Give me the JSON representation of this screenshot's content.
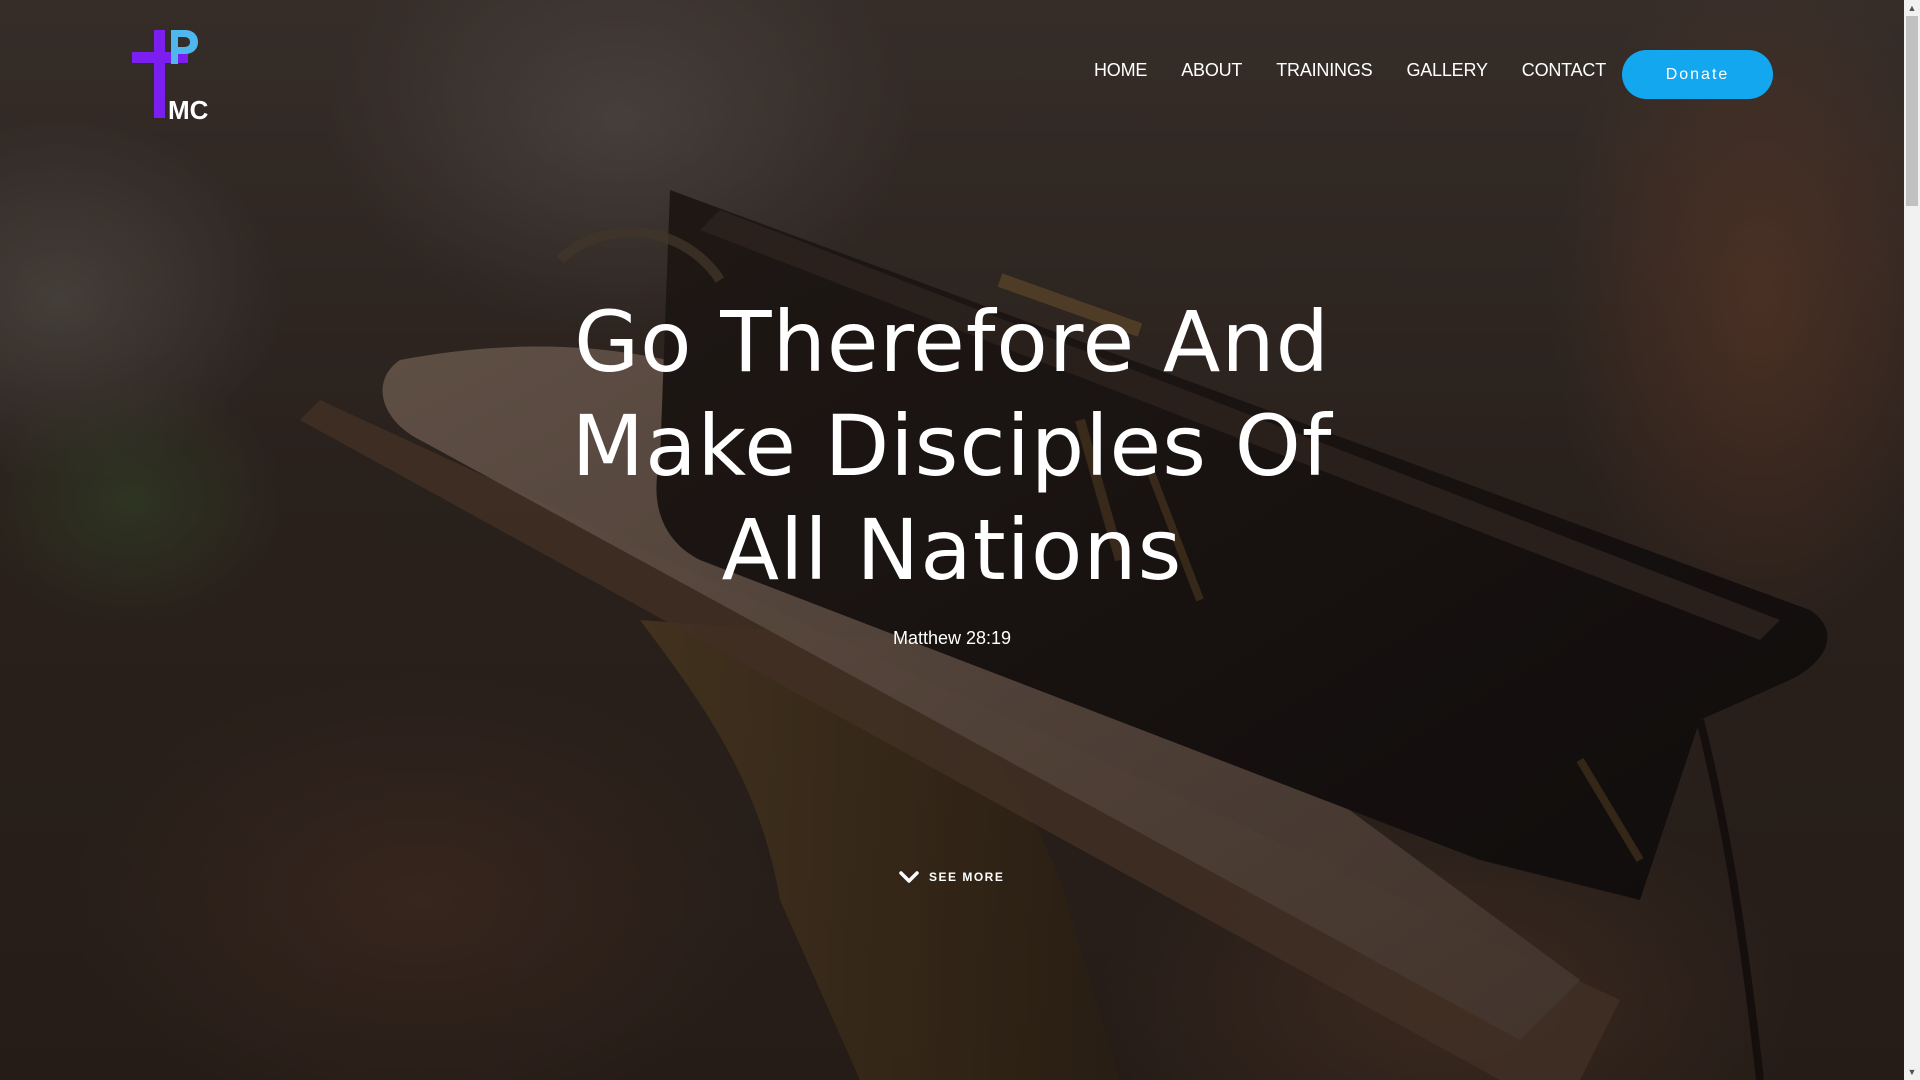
{
  "brand": {
    "logo_letters": "PTMC",
    "logo_mark_text": "MC",
    "colors": {
      "cross": "#7b1ff0",
      "p_letter": "#4fb6ee",
      "mc_text": "#ffffff"
    }
  },
  "nav": {
    "items": [
      {
        "label": "HOME"
      },
      {
        "label": "ABOUT"
      },
      {
        "label": "TRAININGS"
      },
      {
        "label": "GALLERY"
      },
      {
        "label": "CONTACT"
      }
    ]
  },
  "donate": {
    "label": "Donate",
    "color": "#13a7f0"
  },
  "hero": {
    "title_line1": "Go Therefore And",
    "title_line2": "Make Disciples Of",
    "title_line3": "All Nations",
    "reference": "Matthew 28:19",
    "see_more_label": "SEE MORE",
    "see_more_icon": "chevron-down-icon",
    "background_image": "bible-on-lectern-photo"
  },
  "scrollbar": {
    "up_icon": "arrow-up-icon",
    "down_icon": "arrow-down-icon"
  }
}
